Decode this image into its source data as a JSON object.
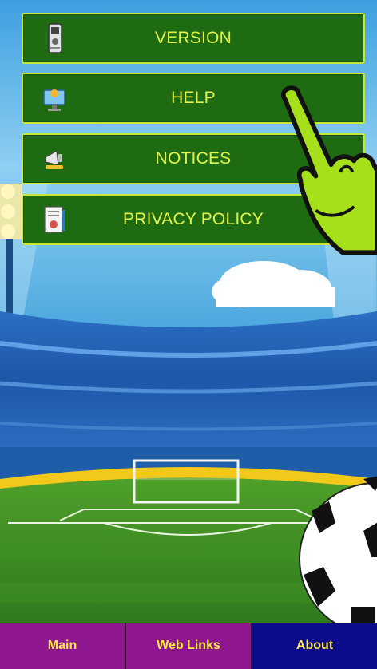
{
  "menu": {
    "items": [
      {
        "label": "VERSION",
        "icon": "phone-icon"
      },
      {
        "label": "HELP",
        "icon": "monitor-help-icon"
      },
      {
        "label": "NOTICES",
        "icon": "megaphone-icon"
      },
      {
        "label": "PRIVACY POLICY",
        "icon": "document-icon"
      }
    ]
  },
  "tabbar": {
    "tabs": [
      {
        "label": "Main"
      },
      {
        "label": "Web Links"
      },
      {
        "label": "About"
      }
    ]
  },
  "colors": {
    "button_bg": "#1f6b12",
    "button_border": "#c7e63a",
    "button_text": "#e3f24a",
    "tab_purple": "#8e168e",
    "tab_blue": "#0c0c8a",
    "tab_text": "#ffe94a"
  },
  "decor": {
    "pointer": "pointing-hand-icon",
    "ball": "soccer-ball-icon"
  }
}
